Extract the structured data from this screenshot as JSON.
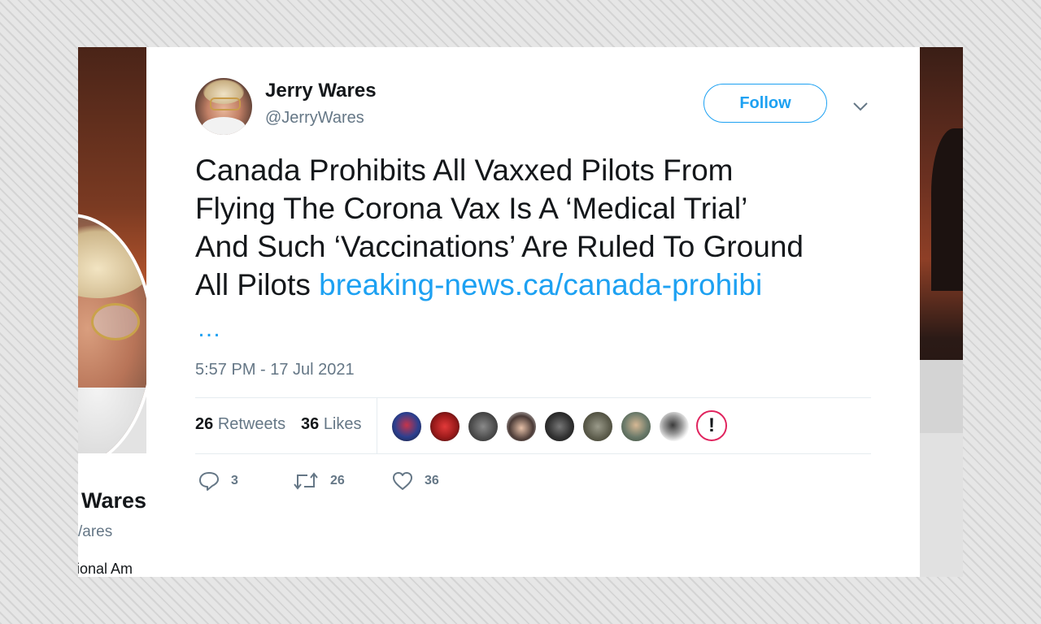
{
  "background_profile": {
    "name": "Wares",
    "handle": "/ares",
    "bio": "ional Am"
  },
  "tweet": {
    "author_name": "Jerry Wares",
    "author_handle": "@JerryWares",
    "follow_label": "Follow",
    "text_lines": [
      "Canada Prohibits All Vaxxed Pilots From",
      "Flying The Corona Vax Is A ‘Medical Trial’",
      "And Such ‘Vaccinations’ Are Ruled To Ground",
      "All Pilots "
    ],
    "link_text": "breaking-news.ca/canada-prohibi",
    "ellipsis": "…",
    "timestamp": "5:57 PM - 17 Jul 2021",
    "stats": {
      "retweets_count": "26",
      "retweets_label": "Retweets",
      "likes_count": "36",
      "likes_label": "Likes"
    },
    "likers_alert_glyph": "!",
    "actions": {
      "reply_count": "3",
      "retweet_count": "26",
      "like_count": "36"
    }
  },
  "colors": {
    "accent": "#1da1f2",
    "text": "#14171a",
    "muted": "#657786"
  }
}
